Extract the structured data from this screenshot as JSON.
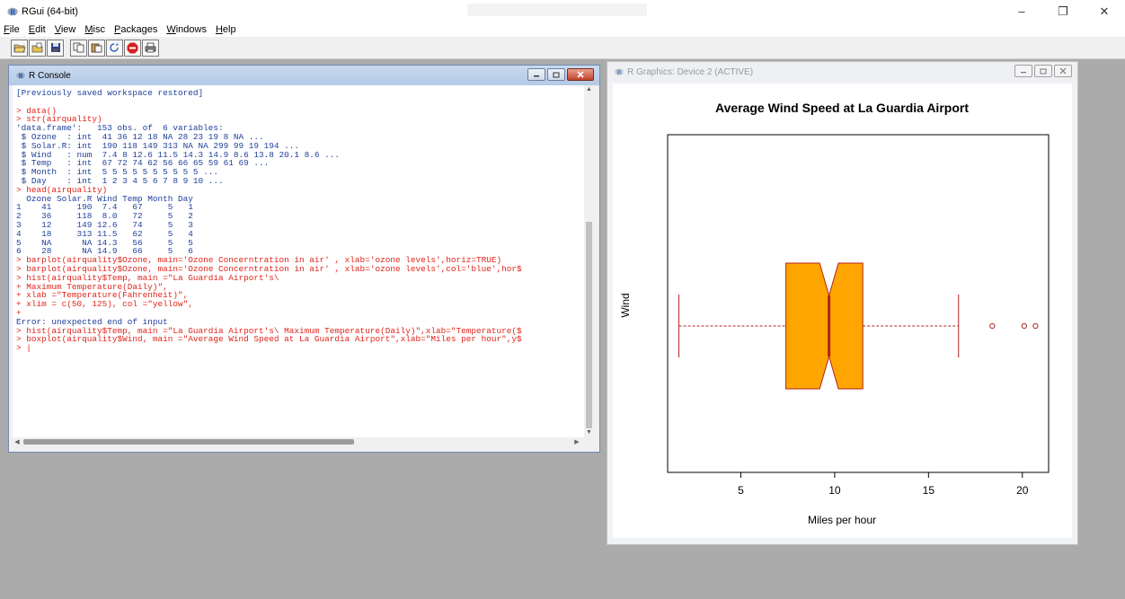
{
  "app": {
    "title": "RGui (64-bit)",
    "controls": {
      "minimize": "–",
      "maximize": "❐",
      "close": "✕"
    }
  },
  "menu": [
    {
      "key": "F",
      "rest": "ile"
    },
    {
      "key": "E",
      "rest": "dit"
    },
    {
      "key": "V",
      "rest": "iew"
    },
    {
      "key": "M",
      "rest": "isc"
    },
    {
      "key": "P",
      "rest": "ackages"
    },
    {
      "key": "W",
      "rest": "indows"
    },
    {
      "key": "H",
      "rest": "elp"
    }
  ],
  "toolbar": {
    "buttons": [
      "open-script-icon",
      "load-workspace-icon",
      "save-icon",
      "copy-icon",
      "paste-icon",
      "copy-paste-icon",
      "stop-icon",
      "print-icon"
    ]
  },
  "console": {
    "title": "R Console",
    "lines": [
      {
        "t": "[Previously saved workspace restored]",
        "k": "out"
      },
      {
        "t": "",
        "k": "blank"
      },
      {
        "t": "> data()",
        "k": "cmd"
      },
      {
        "t": "> str(airquality)",
        "k": "cmd"
      },
      {
        "t": "'data.frame':   153 obs. of  6 variables:",
        "k": "out"
      },
      {
        "t": " $ Ozone  : int  41 36 12 18 NA 28 23 19 8 NA ...",
        "k": "out"
      },
      {
        "t": " $ Solar.R: int  190 118 149 313 NA NA 299 99 19 194 ...",
        "k": "out"
      },
      {
        "t": " $ Wind   : num  7.4 8 12.6 11.5 14.3 14.9 8.6 13.8 20.1 8.6 ...",
        "k": "out"
      },
      {
        "t": " $ Temp   : int  67 72 74 62 56 66 65 59 61 69 ...",
        "k": "out"
      },
      {
        "t": " $ Month  : int  5 5 5 5 5 5 5 5 5 5 ...",
        "k": "out"
      },
      {
        "t": " $ Day    : int  1 2 3 4 5 6 7 8 9 10 ...",
        "k": "out"
      },
      {
        "t": "> head(airquality)",
        "k": "cmd"
      },
      {
        "t": "  Ozone Solar.R Wind Temp Month Day",
        "k": "out"
      },
      {
        "t": "1    41     190  7.4   67     5   1",
        "k": "out"
      },
      {
        "t": "2    36     118  8.0   72     5   2",
        "k": "out"
      },
      {
        "t": "3    12     149 12.6   74     5   3",
        "k": "out"
      },
      {
        "t": "4    18     313 11.5   62     5   4",
        "k": "out"
      },
      {
        "t": "5    NA      NA 14.3   56     5   5",
        "k": "out"
      },
      {
        "t": "6    28      NA 14.9   66     5   6",
        "k": "out"
      },
      {
        "t": "> barplot(airquality$Ozone, main='Ozone Concerntration in air' , xlab='ozone levels',horiz=TRUE)",
        "k": "cmd"
      },
      {
        "t": "> barplot(airquality$Ozone, main='Ozone Concerntration in air' , xlab='ozone levels',col='blue',hor$",
        "k": "cmd"
      },
      {
        "t": "> hist(airquality$Temp, main =\"La Guardia Airport's\\",
        "k": "cmd"
      },
      {
        "t": "+ Maximum Temperature(Daily)\",",
        "k": "cmd"
      },
      {
        "t": "+ xlab =\"Temperature(Fahrenheit)\",",
        "k": "cmd"
      },
      {
        "t": "+ xlim = c(50, 125), col =\"yellow\",",
        "k": "cmd"
      },
      {
        "t": "+",
        "k": "cmd"
      },
      {
        "t": "Error: unexpected end of input",
        "k": "out"
      },
      {
        "t": "> hist(airquality$Temp, main =\"La Guardia Airport's\\ Maximum Temperature(Daily)\",xlab=\"Temperature($",
        "k": "cmd"
      },
      {
        "t": "> boxplot(airquality$Wind, main =\"Average Wind Speed at La Guardia Airport\",xlab=\"Miles per hour\",y$",
        "k": "cmd"
      },
      {
        "t": "> |",
        "k": "cmd"
      }
    ]
  },
  "graphics": {
    "title": "R Graphics: Device 2 (ACTIVE)"
  },
  "chart_data": {
    "type": "boxplot",
    "title": "Average Wind Speed at La Guardia Airport",
    "xlabel": "Miles per hour",
    "ylabel": "Wind",
    "orientation": "horizontal",
    "notch": true,
    "xlim": [
      1.1,
      21.4
    ],
    "xticks": [
      5,
      10,
      15,
      20
    ],
    "stats": {
      "whisker_low": 1.7,
      "q1": 7.4,
      "median": 9.7,
      "q3": 11.5,
      "whisker_high": 16.6,
      "notch_low": 9.2,
      "notch_high": 10.2
    },
    "outliers": [
      18.4,
      20.1,
      20.7
    ],
    "colors": {
      "fill": "#FFA500",
      "border": "#B22222",
      "median": "#B22222",
      "whisker": "#B22222",
      "outlier": "#B22222"
    }
  }
}
